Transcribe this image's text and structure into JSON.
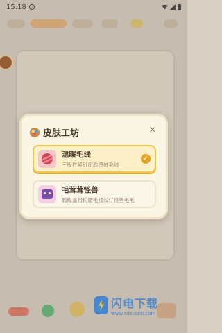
{
  "status": {
    "time": "15:18"
  },
  "modal": {
    "title": "皮肤工坊",
    "close_label": "×",
    "options": [
      {
        "name": "温暖毛线",
        "desc": "三股拧紧针织质感绒毛线",
        "selected": true,
        "icon": "yarn-ball-icon"
      },
      {
        "name": "毛茸茸怪兽",
        "desc": "超级蓬松粉嫩毛线公仔怪兽毛毛",
        "selected": false,
        "icon": "monster-icon"
      }
    ],
    "check": "✓"
  },
  "watermark": {
    "main": "闪电下载",
    "sub": "www.sdxiazai.com"
  },
  "colors": {
    "accent": "#f0c64f",
    "check": "#e2a52a",
    "panel": "#fbf5e6"
  }
}
